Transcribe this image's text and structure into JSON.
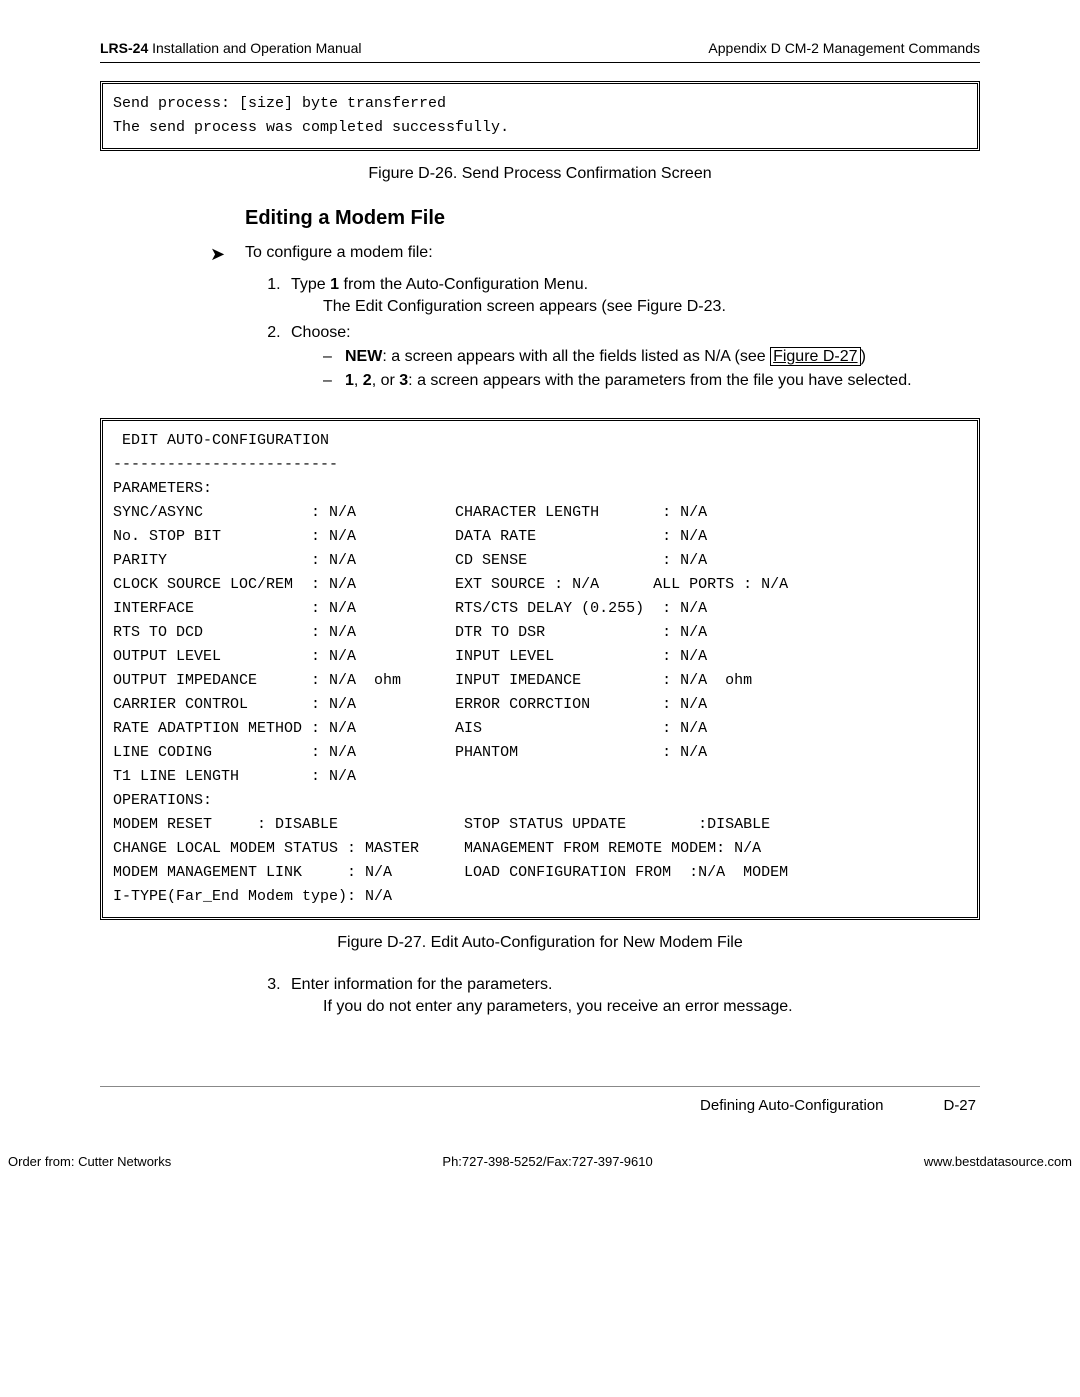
{
  "header": {
    "product": "LRS-24",
    "manual": " Installation and Operation Manual",
    "appendix": "Appendix D CM-2 Management Commands"
  },
  "box1": {
    "line1": "Send process: [size] byte transferred",
    "line2": "The send process was completed successfully."
  },
  "fig26": "Figure D-26.  Send Process Confirmation Screen",
  "section": {
    "title": "Editing a Modem File",
    "lead": "To configure a modem file:",
    "step1": {
      "text_a": "Type ",
      "bold": "1",
      "text_b": " from the Auto-Configuration Menu.",
      "sub_a": "The Edit Configuration screen appears (see ",
      "ref": "Figure D-23",
      "sub_b": "."
    },
    "step2": {
      "text": "Choose:",
      "opt_new_label": "NEW",
      "opt_new_rest": ": a screen appears with all the fields listed as N/A (see ",
      "opt_new_link": "Figure D-27",
      "opt_new_tail": ")",
      "opt_123_label": "1",
      "opt_123_sep1": ", ",
      "opt_123_label2": "2",
      "opt_123_sep2": ", or ",
      "opt_123_label3": "3",
      "opt_123_rest": ": a screen appears with the parameters from the file you have selected."
    }
  },
  "box2": {
    "title": " EDIT AUTO-CONFIGURATION",
    "underline": "-------------------------",
    "params_label": "PARAMETERS:",
    "rows": [
      "SYNC/ASYNC            : N/A           CHARACTER LENGTH       : N/A",
      "No. STOP BIT          : N/A           DATA RATE              : N/A",
      "PARITY                : N/A           CD SENSE               : N/A",
      "CLOCK SOURCE LOC/REM  : N/A           EXT SOURCE : N/A      ALL PORTS : N/A",
      "INTERFACE             : N/A           RTS/CTS DELAY (0.255)  : N/A",
      "RTS TO DCD            : N/A           DTR TO DSR             : N/A",
      "OUTPUT LEVEL          : N/A           INPUT LEVEL            : N/A",
      "OUTPUT IMPEDANCE      : N/A  ohm      INPUT IMEDANCE         : N/A  ohm",
      "CARRIER CONTROL       : N/A           ERROR CORRCTION        : N/A",
      "RATE ADATPTION METHOD : N/A           AIS                    : N/A",
      "LINE CODING           : N/A           PHANTOM                : N/A",
      "T1 LINE LENGTH        : N/A"
    ],
    "ops_label": "OPERATIONS:",
    "ops_rows": [
      "MODEM RESET     : DISABLE              STOP STATUS UPDATE        :DISABLE",
      "CHANGE LOCAL MODEM STATUS : MASTER     MANAGEMENT FROM REMOTE MODEM: N/A",
      "MODEM MANAGEMENT LINK     : N/A        LOAD CONFIGURATION FROM  :N/A  MODEM",
      "I-TYPE(Far_End Modem type): N/A"
    ]
  },
  "fig27": "Figure D-27.  Edit Auto-Configuration for New Modem File",
  "step3": {
    "text": "Enter information for the parameters.",
    "sub": "If you do not enter any parameters, you receive an error message."
  },
  "footer": {
    "section_name": "Defining Auto-Configuration",
    "page": "D-27",
    "order": "Order from: Cutter Networks",
    "phone": "Ph:727-398-5252/Fax:727-397-9610",
    "url": "www.bestdatasource.com"
  }
}
